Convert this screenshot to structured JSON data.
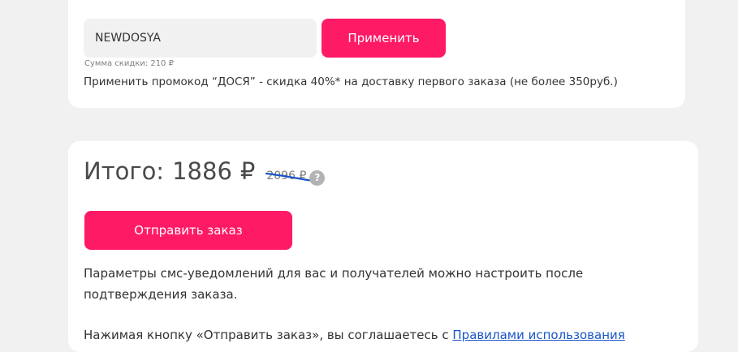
{
  "promo": {
    "code_value": "NEWDOSYA",
    "apply_label": "Применить",
    "discount_sum": "Сумма скидки: 210 ₽",
    "hint": "Применить промокод “ДОСЯ” - скидка 40%* на доставку первого заказа (не более 350руб.)"
  },
  "total": {
    "label": "Итого:",
    "amount": "1886",
    "currency": "₽",
    "old_price": "2096 ₽",
    "help_glyph": "?",
    "submit_label": "Отправить заказ",
    "sms_note": "Параметры смс-уведомлений для вас и получателей можно настроить после подтверждения заказа.",
    "agree_prefix": "Нажимая кнопку «Отправить заказ», вы соглашаетесь с ",
    "agree_link": "Правилами использования"
  },
  "colors": {
    "accent": "#ff1a66",
    "background": "#f1f1f1",
    "link": "#1a55c9",
    "strike": "#1a55c9"
  }
}
